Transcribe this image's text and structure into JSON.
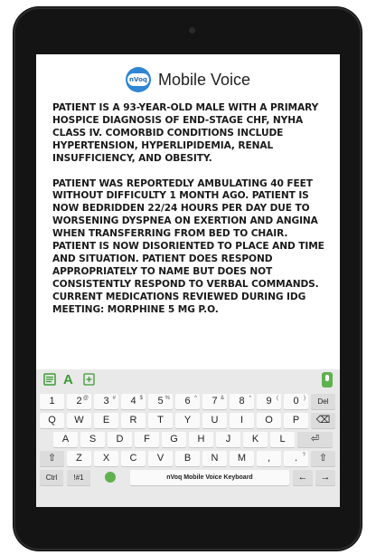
{
  "app": {
    "logo_text": "nVoq",
    "title": "Mobile Voice"
  },
  "transcript": {
    "paragraphs": [
      "PATIENT IS A 93-YEAR-OLD MALE WITH A PRIMARY HOSPICE DIAGNOSIS OF END-STAGE CHF, NYHA CLASS IV. COMORBID CONDITIONS INCLUDE HYPERTENSION, HYPERLIPIDEMIA, RENAL INSUFFICIENCY, AND OBESITY.",
      "PATIENT WAS REPORTEDLY AMBULATING 40 FEET WITHOUT DIFFICULTY 1 MONTH AGO. PATIENT IS NOW BEDRIDDEN 22/24 HOURS PER DAY DUE TO WORSENING DYSPNEA ON EXERTION AND ANGINA WHEN TRANSFERRING FROM BED TO CHAIR. PATIENT IS NOW DISORIENTED TO PLACE AND TIME AND SITUATION. PATIENT DOES RESPOND APPROPRIATELY TO NAME BUT DOES NOT CONSISTENTLY RESPOND TO VERBAL COMMANDS. CURRENT MEDICATIONS REVIEWED DURING IDG MEETING: MORPHINE 5 MG P.O."
    ]
  },
  "keyboard": {
    "toolbar": {
      "notes_icon": "notes-icon",
      "text_icon_label": "A",
      "add_icon": "add-icon",
      "mic_icon": "mic-icon",
      "accent_color": "#3d9b35"
    },
    "row1": [
      {
        "label": "1",
        "sup": ""
      },
      {
        "label": "2",
        "sup": "@"
      },
      {
        "label": "3",
        "sup": "#"
      },
      {
        "label": "4",
        "sup": "$"
      },
      {
        "label": "5",
        "sup": "%"
      },
      {
        "label": "6",
        "sup": "^"
      },
      {
        "label": "7",
        "sup": "&"
      },
      {
        "label": "8",
        "sup": "*"
      },
      {
        "label": "9",
        "sup": "("
      },
      {
        "label": "0",
        "sup": ")"
      },
      {
        "label": "Del",
        "sup": ""
      }
    ],
    "row2": [
      "Q",
      "W",
      "E",
      "R",
      "T",
      "Y",
      "U",
      "I",
      "O",
      "P",
      "⌫"
    ],
    "row3": [
      "A",
      "S",
      "D",
      "F",
      "G",
      "H",
      "J",
      "K",
      "L",
      "⏎"
    ],
    "row4": [
      "⇧",
      "Z",
      "X",
      "C",
      "V",
      "B",
      "N",
      "M",
      ",",
      ".",
      "⇧"
    ],
    "row4_sups": [
      "",
      "",
      "",
      "",
      "",
      "",
      "",
      "",
      "",
      "?",
      ""
    ],
    "row5": {
      "ctrl": "Ctrl",
      "sym": "!#1",
      "space": "nVoq Mobile Voice Keyboard",
      "left": "←",
      "right": "→"
    }
  }
}
